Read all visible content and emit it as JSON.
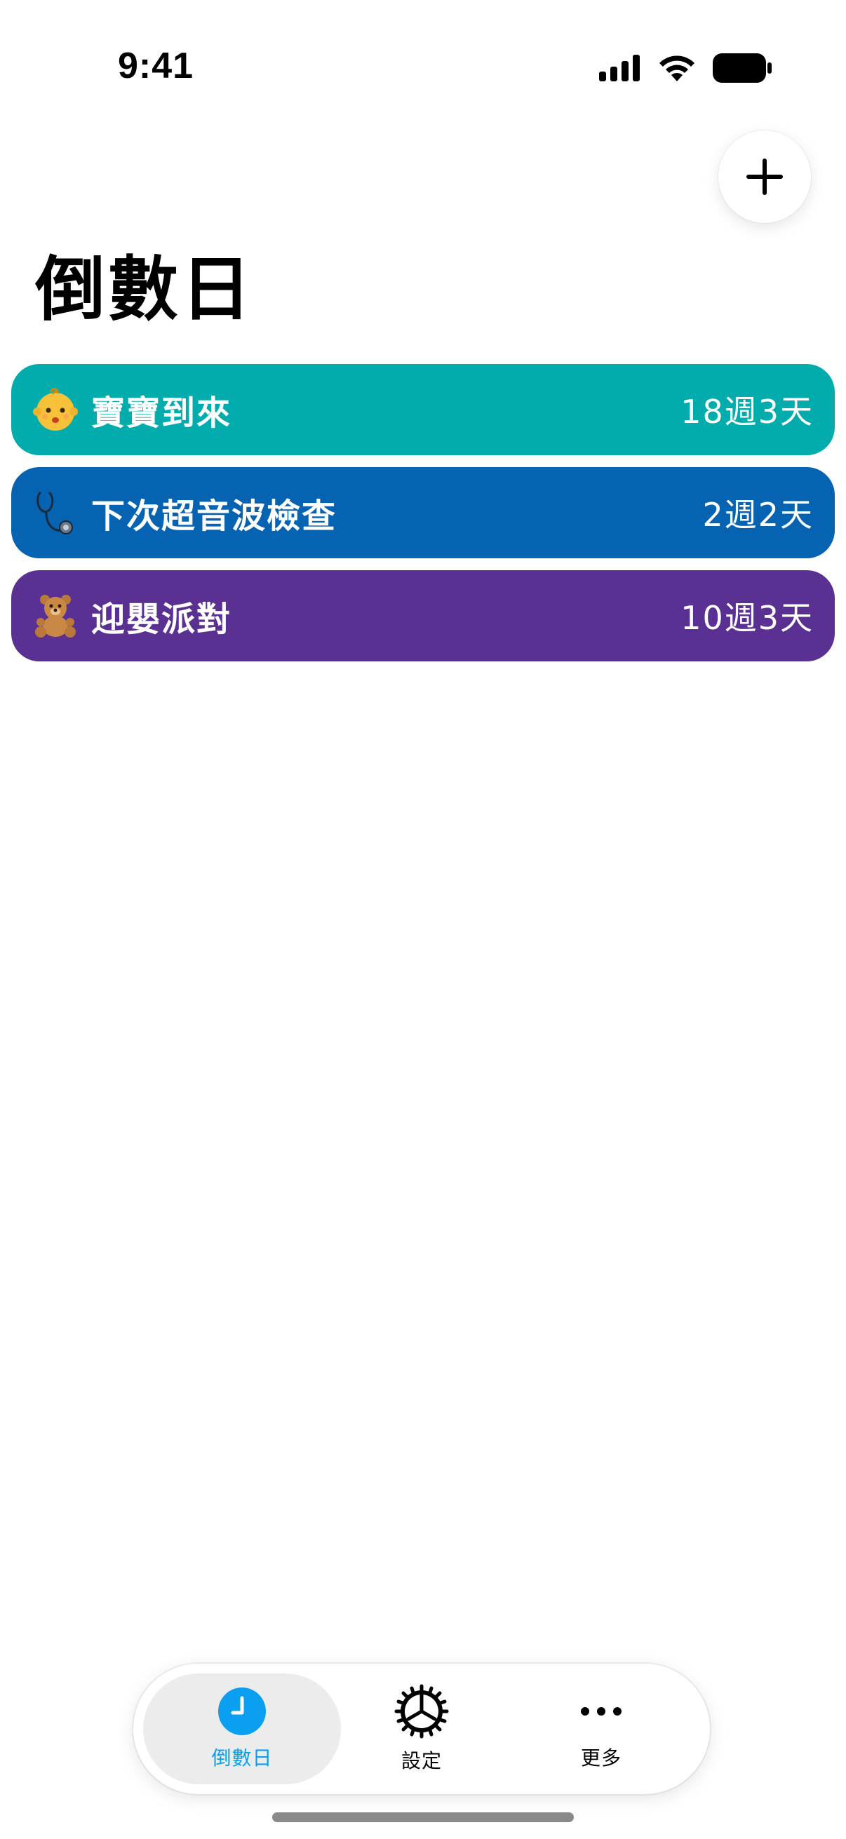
{
  "status_bar": {
    "time": "9:41"
  },
  "header": {
    "title": "倒數日",
    "add_icon": "plus-icon"
  },
  "countdowns": [
    {
      "emoji": "baby-face",
      "title": "寶寶到來",
      "value": "18週3天",
      "color": "#03ACAC"
    },
    {
      "emoji": "stethoscope",
      "title": "下次超音波檢查",
      "value": "2週2天",
      "color": "#0563B2"
    },
    {
      "emoji": "teddy-bear",
      "title": "迎嬰派對",
      "value": "10週3天",
      "color": "#5A3193"
    }
  ],
  "tab_bar": {
    "tabs": [
      {
        "label": "倒數日",
        "icon": "clock-icon",
        "active": true,
        "color": "#0A9FF0"
      },
      {
        "label": "設定",
        "icon": "gear-icon",
        "active": false
      },
      {
        "label": "更多",
        "icon": "ellipsis-icon",
        "active": false
      }
    ]
  }
}
